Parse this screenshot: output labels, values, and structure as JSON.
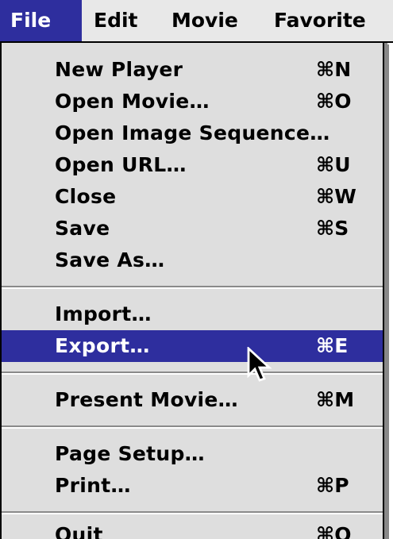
{
  "menubar": {
    "items": [
      {
        "label": "File"
      },
      {
        "label": "Edit"
      },
      {
        "label": "Movie"
      },
      {
        "label": "Favorite"
      }
    ]
  },
  "file_menu": {
    "items": [
      {
        "label": "New Player",
        "shortcut": "⌘N"
      },
      {
        "label": "Open Movie…",
        "shortcut": "⌘O"
      },
      {
        "label": "Open Image Sequence…",
        "shortcut": ""
      },
      {
        "label": "Open URL…",
        "shortcut": "⌘U"
      },
      {
        "label": "Close",
        "shortcut": "⌘W"
      },
      {
        "label": "Save",
        "shortcut": "⌘S"
      },
      {
        "label": "Save As…",
        "shortcut": ""
      },
      {
        "label": "Import…",
        "shortcut": ""
      },
      {
        "label": "Export…",
        "shortcut": "⌘E"
      },
      {
        "label": "Present Movie…",
        "shortcut": "⌘M"
      },
      {
        "label": "Page Setup…",
        "shortcut": ""
      },
      {
        "label": "Print…",
        "shortcut": "⌘P"
      },
      {
        "label": "Quit",
        "shortcut": "⌘Q"
      }
    ]
  },
  "colors": {
    "highlight": "#2e2e9e",
    "menu_background": "#dedede"
  },
  "cursor_icon": "arrow-pointer-icon"
}
